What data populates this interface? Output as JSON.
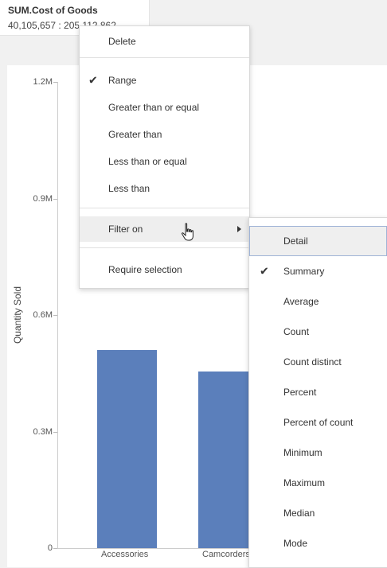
{
  "filter_card": {
    "title": "SUM.Cost of Goods",
    "value": "40,105,657 : 205,112,862"
  },
  "chart_data": {
    "type": "bar",
    "ylabel": "Quantity Sold",
    "yticks": [
      "1.2M",
      "0.9M",
      "0.6M",
      "0.3M",
      "0"
    ],
    "ylim": [
      0,
      1200000
    ],
    "categories": [
      "Accessories",
      "Camcorders"
    ],
    "values": [
      510000,
      455000
    ],
    "color": "#5b7fbb"
  },
  "context_menu": {
    "items": [
      {
        "label": "Delete",
        "checked": false
      },
      {
        "label": "Range",
        "checked": true
      },
      {
        "label": "Greater than or equal",
        "checked": false
      },
      {
        "label": "Greater than",
        "checked": false
      },
      {
        "label": "Less than or equal",
        "checked": false
      },
      {
        "label": "Less than",
        "checked": false
      },
      {
        "label": "Filter on",
        "checked": false,
        "has_submenu": true
      },
      {
        "label": "Require selection",
        "checked": false
      }
    ],
    "check_glyph": "✔"
  },
  "submenu": {
    "items": [
      {
        "label": "Detail",
        "checked": false,
        "selected": true
      },
      {
        "label": "Summary",
        "checked": true
      },
      {
        "label": "Average",
        "checked": false
      },
      {
        "label": "Count",
        "checked": false
      },
      {
        "label": "Count distinct",
        "checked": false
      },
      {
        "label": "Percent",
        "checked": false
      },
      {
        "label": "Percent of count",
        "checked": false
      },
      {
        "label": "Minimum",
        "checked": false
      },
      {
        "label": "Maximum",
        "checked": false
      },
      {
        "label": "Median",
        "checked": false
      },
      {
        "label": "Mode",
        "checked": false
      }
    ]
  }
}
